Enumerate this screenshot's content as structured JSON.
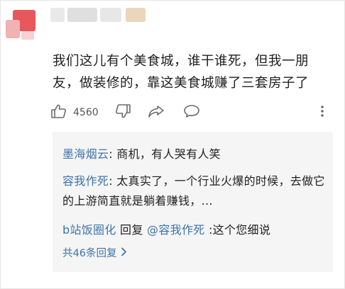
{
  "comment": {
    "text": "我们这儿有个美食城，谁干谁死，但我一朋友，做装修的，靠这美食城赚了三套房子了",
    "like_count": "4560"
  },
  "replies": [
    {
      "name": "墨海烟云",
      "sep": ": ",
      "text": "商机，有人哭有人笑"
    },
    {
      "name": "容我作死",
      "sep": ": ",
      "text": "太真实了，一个行业火爆的时候，去做它的上游简直就是躺着赚钱，..."
    },
    {
      "name": "b站饭圈化",
      "reply_word": " 回复 ",
      "target": "@容我作死",
      "sep": " :",
      "text": "这个您细说"
    }
  ],
  "more_replies_label": "共46条回复",
  "icons": {
    "like": "thumbs-up-icon",
    "dislike": "thumbs-down-icon",
    "share": "share-arrow-icon",
    "comment": "chat-bubble-icon",
    "more": "more-vertical-icon"
  },
  "colors": {
    "link": "#3d74ac",
    "text": "#1f1f1f",
    "reply_bg": "#f5f5f5",
    "avatar": "#e8575a"
  }
}
